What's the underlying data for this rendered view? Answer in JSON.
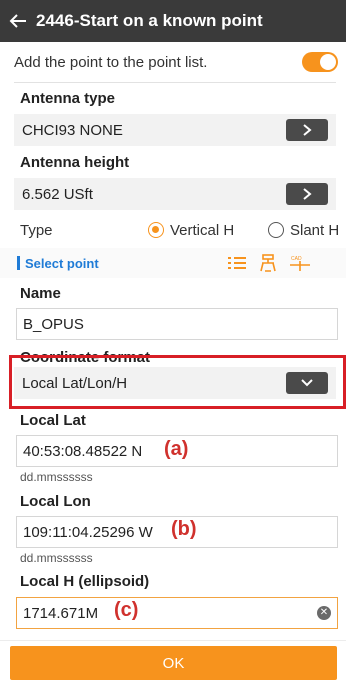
{
  "header": {
    "title": "2446-Start on a known point"
  },
  "add_point": {
    "label": "Add the point to the point list.",
    "enabled": true
  },
  "antenna_type": {
    "label": "Antenna type",
    "value": "CHCI93 NONE"
  },
  "antenna_height": {
    "label": "Antenna height",
    "value": "6.562 USft"
  },
  "type_row": {
    "label": "Type",
    "options": [
      "Vertical H",
      "Slant H"
    ],
    "selected": "Vertical H"
  },
  "select_point": {
    "label": "Select point"
  },
  "name": {
    "label": "Name",
    "value": "B_OPUS"
  },
  "coord_format": {
    "label": "Coordinate format",
    "value": "Local Lat/Lon/H"
  },
  "local_lat": {
    "label": "Local Lat",
    "value": "40:53:08.48522 N",
    "hint": "dd.mmssssss",
    "annotation": "(a)"
  },
  "local_lon": {
    "label": "Local Lon",
    "value": "109:11:04.25296 W",
    "hint": "dd.mmssssss",
    "annotation": "(b)"
  },
  "local_h": {
    "label": "Local H (ellipsoid)",
    "value": "1714.671M",
    "annotation": "(c)"
  },
  "ok_button": {
    "label": "OK"
  },
  "colors": {
    "accent": "#f7931d",
    "header": "#3a3a3a",
    "link": "#1f7bd6",
    "annotation": "#d0312d"
  }
}
